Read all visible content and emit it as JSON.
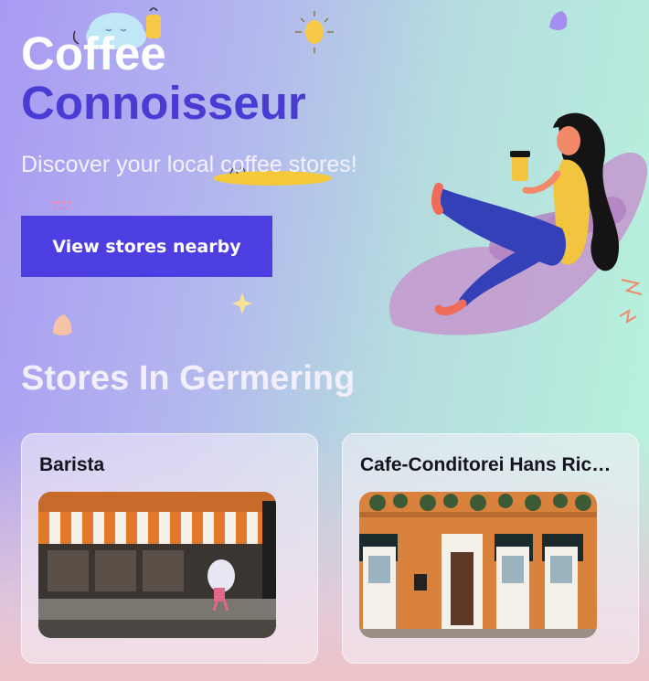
{
  "hero": {
    "title_line1": "Coffee",
    "title_line2": "Connoisseur",
    "subtitle": "Discover your local coffee stores!",
    "cta_label": "View stores nearby"
  },
  "section": {
    "title": "Stores In Germering"
  },
  "stores": [
    {
      "name": "Barista",
      "image": "orange-striped-awning-storefront"
    },
    {
      "name": "Cafe-Conditorei Hans Ric…",
      "image": "orange-facade-white-doors-storefront"
    }
  ],
  "colors": {
    "accent": "#4c3ee0",
    "title_dark": "#4a3bd3",
    "text_light": "#ffffff"
  }
}
